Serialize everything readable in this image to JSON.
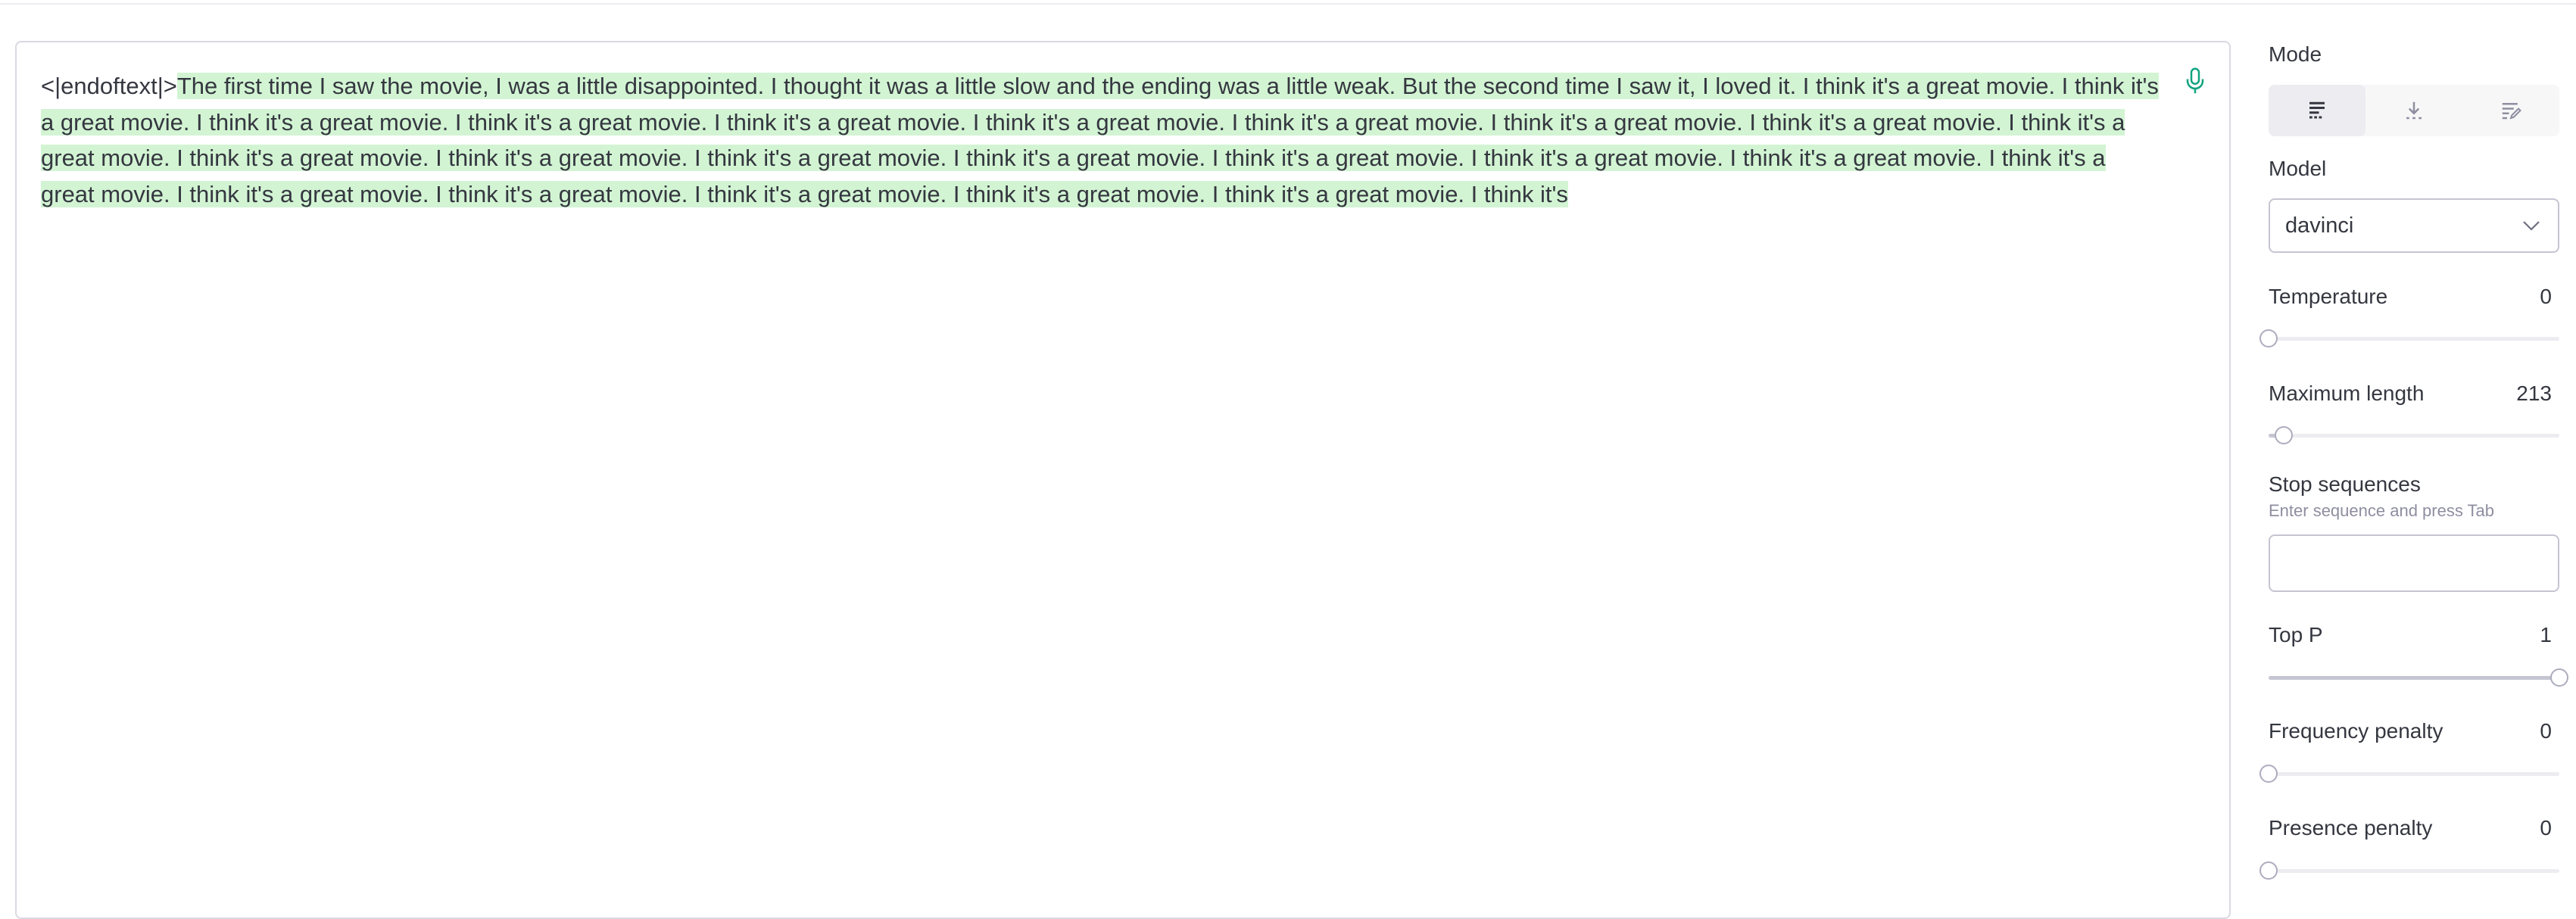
{
  "editor": {
    "prompt": "<|endoftext|>",
    "completion": "The first time I saw the movie, I was a little disappointed. I thought it was a little slow and the ending was a little weak. But the second time I saw it, I loved it. I think it's a great movie. I think it's a great movie. I think it's a great movie. I think it's a great movie. I think it's a great movie. I think it's a great movie. I think it's a great movie. I think it's a great movie. I think it's a great movie. I think it's a great movie. I think it's a great movie. I think it's a great movie. I think it's a great movie. I think it's a great movie. I think it's a great movie. I think it's a great movie. I think it's a great movie. I think it's a great movie. I think it's a great movie. I think it's a great movie. I think it's a great movie. I think it's a great movie. I think it's a great movie. I think it's",
    "highlight_color": "#d2f4d3",
    "mic_icon": "microphone-icon"
  },
  "sidebar": {
    "mode": {
      "label": "Mode",
      "options": [
        {
          "icon": "complete-mode-icon",
          "active": true
        },
        {
          "icon": "insert-mode-icon",
          "active": false
        },
        {
          "icon": "edit-mode-icon",
          "active": false
        }
      ]
    },
    "model": {
      "label": "Model",
      "value": "davinci",
      "icon": "chevron-down-icon"
    },
    "temperature": {
      "label": "Temperature",
      "value": "0",
      "fraction": 0.0
    },
    "max_length": {
      "label": "Maximum length",
      "value": "213",
      "fraction": 0.052
    },
    "stop_sequences": {
      "label": "Stop sequences",
      "hint": "Enter sequence and press Tab",
      "value": ""
    },
    "top_p": {
      "label": "Top P",
      "value": "1",
      "fraction": 1.0
    },
    "frequency_penalty": {
      "label": "Frequency penalty",
      "value": "0",
      "fraction": 0.0
    },
    "presence_penalty": {
      "label": "Presence penalty",
      "value": "0",
      "fraction": 0.0
    }
  },
  "colors": {
    "accent_green": "#10a37f",
    "border": "#d9d9e3",
    "text": "#353740",
    "muted": "#8e8ea0"
  }
}
